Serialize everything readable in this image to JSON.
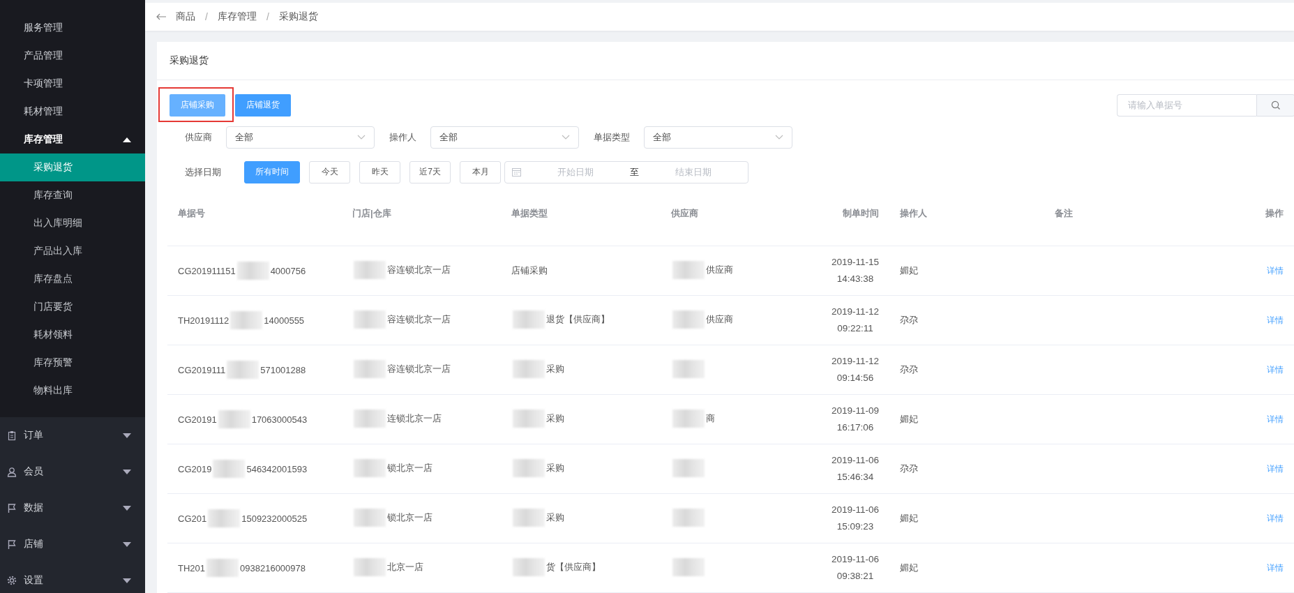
{
  "sidebar": {
    "items": [
      {
        "label": "服务管理"
      },
      {
        "label": "产品管理"
      },
      {
        "label": "卡项管理"
      },
      {
        "label": "耗材管理"
      },
      {
        "label": "库存管理",
        "expanded": true,
        "children": [
          {
            "label": "采购退货",
            "selected": true
          },
          {
            "label": "库存查询",
            "selected": false
          },
          {
            "label": "出入库明细",
            "selected": false
          },
          {
            "label": "产品出入库",
            "selected": false
          },
          {
            "label": "库存盘点",
            "selected": false
          },
          {
            "label": "门店要货",
            "selected": false
          },
          {
            "label": "耗材领料",
            "selected": false
          },
          {
            "label": "库存预警",
            "selected": false
          },
          {
            "label": "物料出库",
            "selected": false
          }
        ]
      }
    ],
    "sections": [
      {
        "label": "订单",
        "kind": "clipboard",
        "expanded": false
      },
      {
        "label": "会员",
        "kind": "person",
        "expanded": false
      },
      {
        "label": "数据",
        "kind": "flag",
        "expanded": false
      },
      {
        "label": "店铺",
        "kind": "flag",
        "expanded": false
      },
      {
        "label": "设置",
        "kind": "gear",
        "expanded": false
      }
    ]
  },
  "breadcrumb": [
    {
      "label": "商品",
      "separator": "/"
    },
    {
      "label": "库存管理",
      "separator": "/"
    },
    {
      "label": "采购退货"
    }
  ],
  "card": {
    "title": "采购退货",
    "actions": [
      {
        "label": "店铺采购",
        "highlighted": true
      },
      {
        "label": "店铺退货",
        "highlighted": false
      }
    ],
    "search": {
      "placeholder": "请输入单据号"
    },
    "filters": [
      {
        "label": "供应商",
        "value": "全部"
      },
      {
        "label": "操作人",
        "value": "全部"
      },
      {
        "label": "单据类型",
        "value": "全部"
      }
    ],
    "date_filter": {
      "label": "选择日期",
      "options": [
        {
          "label": "所有时间",
          "selected": true
        },
        {
          "label": "今天",
          "selected": false
        },
        {
          "label": "昨天",
          "selected": false
        },
        {
          "label": "近7天",
          "selected": false
        },
        {
          "label": "本月",
          "selected": false
        }
      ],
      "start_placeholder": "开始日期",
      "separator": "至",
      "end_placeholder": "结束日期"
    },
    "table": {
      "columns": [
        "单据号",
        "门店|仓库",
        "单据类型",
        "供应商",
        "制单时间",
        "操作人",
        "备注",
        "操作"
      ],
      "rows": [
        {
          "number": {
            "before": "CG201911151",
            "redacted": true,
            "after": "4000756"
          },
          "store": {
            "redacted": true,
            "after": "容连锁北京一店"
          },
          "type": {
            "redacted": false,
            "after": "店铺采购"
          },
          "supplier": {
            "redacted": true,
            "after": "供应商"
          },
          "date": "2019-11-15",
          "time": "14:43:38",
          "operator": "媚妃",
          "action": "详情"
        },
        {
          "number": {
            "before": "TH20191112",
            "redacted": true,
            "after": "14000555"
          },
          "store": {
            "redacted": true,
            "after": "容连锁北京一店"
          },
          "type": {
            "redacted": true,
            "after": "退货【供应商】"
          },
          "supplier": {
            "redacted": true,
            "after": "供应商"
          },
          "date": "2019-11-12",
          "time": "09:22:11",
          "operator": "尕尕",
          "action": "详情"
        },
        {
          "number": {
            "before": "CG2019111",
            "redacted": true,
            "after": "571001288"
          },
          "store": {
            "redacted": true,
            "after": "容连锁北京一店"
          },
          "type": {
            "redacted": true,
            "after": "采购"
          },
          "supplier": {
            "redacted": true
          },
          "date": "2019-11-12",
          "time": "09:14:56",
          "operator": "尕尕",
          "action": "详情"
        },
        {
          "number": {
            "before": "CG20191",
            "redacted": true,
            "after": "17063000543"
          },
          "store": {
            "redacted": true,
            "after": "连锁北京一店"
          },
          "type": {
            "redacted": true,
            "after": "采购"
          },
          "supplier": {
            "redacted": true,
            "after": "商"
          },
          "date": "2019-11-09",
          "time": "16:17:06",
          "operator": "媚妃",
          "action": "详情"
        },
        {
          "number": {
            "before": "CG2019",
            "redacted": true,
            "after": "546342001593"
          },
          "store": {
            "redacted": true,
            "after": "锁北京一店"
          },
          "type": {
            "redacted": true,
            "after": "采购"
          },
          "supplier": {
            "redacted": true
          },
          "date": "2019-11-06",
          "time": "15:46:34",
          "operator": "尕尕",
          "action": "详情"
        },
        {
          "number": {
            "before": "CG201",
            "redacted": true,
            "after": "1509232000525"
          },
          "store": {
            "redacted": true,
            "after": "锁北京一店"
          },
          "type": {
            "redacted": true,
            "after": "采购"
          },
          "supplier": {
            "redacted": true
          },
          "date": "2019-11-06",
          "time": "15:09:23",
          "operator": "媚妃",
          "action": "详情"
        },
        {
          "number": {
            "before": "TH201",
            "redacted": true,
            "after": "0938216000978"
          },
          "store": {
            "redacted": true,
            "after": "北京一店"
          },
          "type": {
            "redacted": true,
            "after": "货【供应商】"
          },
          "supplier": {
            "redacted": true
          },
          "date": "2019-11-06",
          "time": "09:38:21",
          "operator": "媚妃",
          "action": "详情"
        }
      ]
    }
  }
}
